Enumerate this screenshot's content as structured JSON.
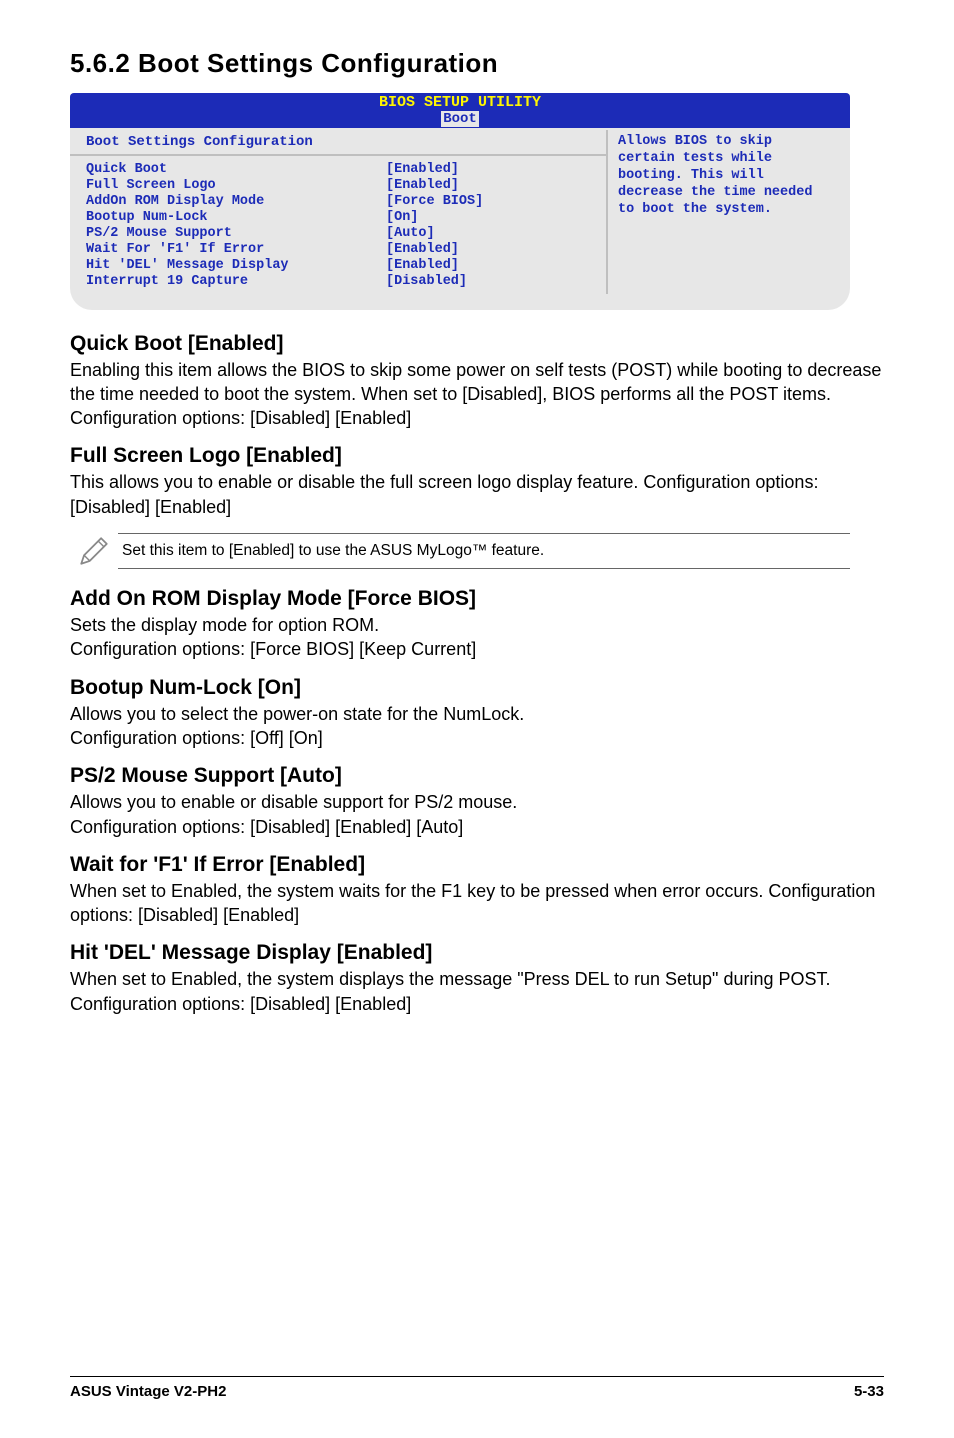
{
  "heading": "5.6.2   Boot Settings Configuration",
  "bios": {
    "title": "BIOS SETUP UTILITY",
    "tab": "Boot",
    "config_heading": "Boot Settings Configuration",
    "rows": [
      {
        "label": "Quick Boot",
        "value": "[Enabled]"
      },
      {
        "label": "Full Screen Logo",
        "value": "[Enabled]"
      },
      {
        "label": "AddOn ROM Display Mode",
        "value": "[Force BIOS]"
      },
      {
        "label": "Bootup Num-Lock",
        "value": "[On]"
      },
      {
        "label": "PS/2 Mouse Support",
        "value": "[Auto]"
      },
      {
        "label": "Wait For 'F1' If Error",
        "value": "[Enabled]"
      },
      {
        "label": "Hit 'DEL' Message Display",
        "value": "[Enabled]"
      },
      {
        "label": "Interrupt 19 Capture",
        "value": "[Disabled]"
      }
    ],
    "help": "Allows BIOS to skip certain tests while booting. This will decrease the time needed to boot the system."
  },
  "sections": [
    {
      "title": "Quick Boot [Enabled]",
      "body": "Enabling this item allows the BIOS to skip some power on self tests (POST) while booting to decrease the time needed to boot the system. When set to [Disabled], BIOS performs all the POST items.\nConfiguration options: [Disabled] [Enabled]"
    },
    {
      "title": "Full Screen Logo [Enabled]",
      "body": "This allows you to enable or disable the full screen logo display feature. Configuration options: [Disabled] [Enabled]"
    }
  ],
  "note": "Set this item to [Enabled] to use the ASUS MyLogo™ feature.",
  "sections2": [
    {
      "title": "Add On ROM Display Mode [Force BIOS]",
      "body": "Sets the display mode for option ROM.\nConfiguration options: [Force BIOS] [Keep Current]"
    },
    {
      "title": "Bootup Num-Lock [On]",
      "body": "Allows you to select the power-on state for the NumLock.\nConfiguration options: [Off] [On]"
    },
    {
      "title": "PS/2 Mouse Support [Auto]",
      "body": "Allows you to enable or disable support for PS/2 mouse.\nConfiguration options: [Disabled] [Enabled] [Auto]"
    },
    {
      "title": "Wait for 'F1' If Error [Enabled]",
      "body": "When set to Enabled, the system waits for the F1 key to be pressed when error occurs. Configuration options: [Disabled] [Enabled]"
    },
    {
      "title": "Hit 'DEL' Message Display [Enabled]",
      "body": "When set to Enabled, the system displays the message \"Press DEL to run Setup\" during POST. Configuration options: [Disabled] [Enabled]"
    }
  ],
  "footer": {
    "left": "ASUS Vintage V2-PH2",
    "right": "5-33"
  }
}
